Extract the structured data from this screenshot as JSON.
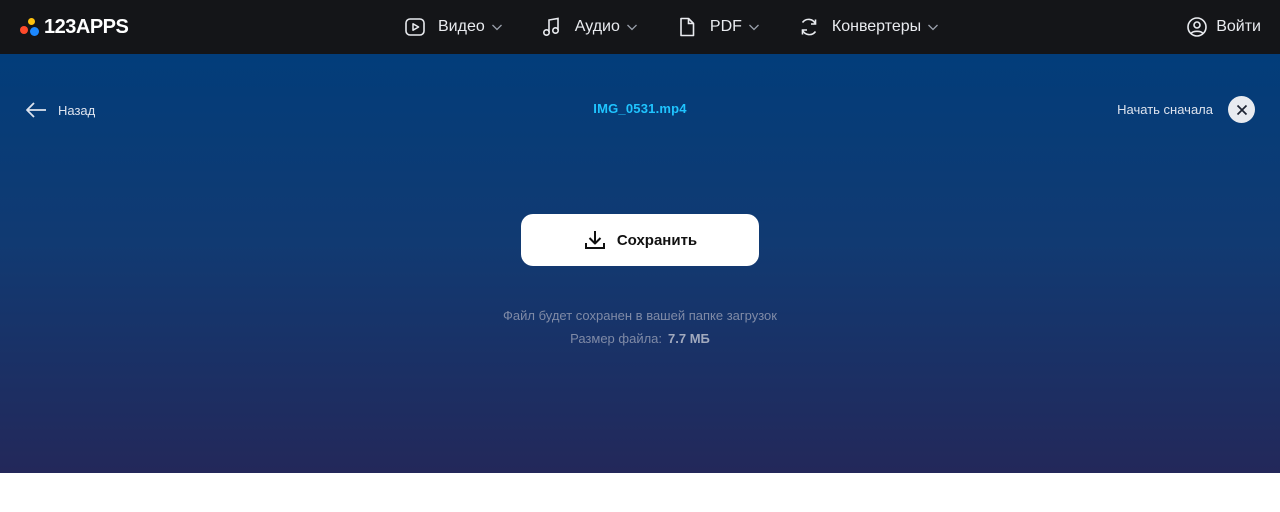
{
  "brand": {
    "logo_text": "123APPS",
    "dot_colors": [
      "#ffc20e",
      "#1c88ff",
      "#ff4a2b"
    ]
  },
  "nav": {
    "items": [
      {
        "label": "Видео",
        "icon": "video-play-icon"
      },
      {
        "label": "Аудио",
        "icon": "music-note-icon"
      },
      {
        "label": "PDF",
        "icon": "document-icon"
      },
      {
        "label": "Конвертеры",
        "icon": "convert-cycle-icon"
      }
    ],
    "login_label": "Войти"
  },
  "toolbar": {
    "back_label": "Назад",
    "file_name": "IMG_0531.mp4",
    "restart_label": "Начать сначала"
  },
  "main": {
    "save_label": "Сохранить",
    "hint": "Файл будет сохранен в вашей папке загрузок",
    "size_label": "Размер файла:",
    "size_value": "7.7 МБ"
  },
  "colors": {
    "topbar": "#141518",
    "panel_top": "#023d7a",
    "panel_bottom": "#23285a",
    "file_name": "#1fc4ff",
    "button_bg": "#ffffff"
  }
}
